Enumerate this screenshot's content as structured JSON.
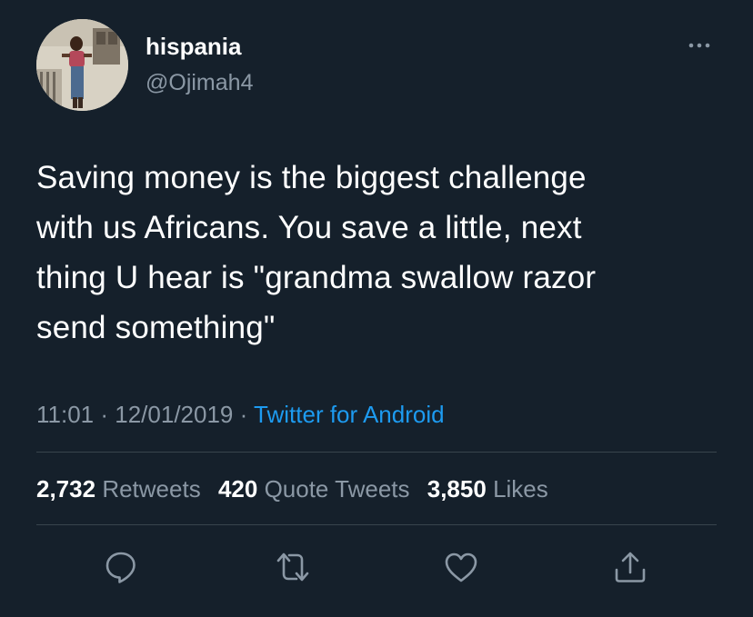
{
  "user": {
    "display_name": "hispania",
    "handle": "@Ojimah4"
  },
  "tweet": {
    "text": "Saving money is the biggest challenge\nwith us Africans. You save a little, next\nthing U hear is \"grandma swallow razor\nsend something\"",
    "time": "11:01",
    "date": "12/01/2019",
    "separator": " · ",
    "source": "Twitter for Android"
  },
  "stats": {
    "retweets_count": "2,732",
    "retweets_label": "Retweets",
    "quotes_count": "420",
    "quotes_label": "Quote Tweets",
    "likes_count": "3,850",
    "likes_label": "Likes"
  },
  "icons": {
    "more": "more-horizontal-icon",
    "reply": "reply-icon",
    "retweet": "retweet-icon",
    "like": "heart-icon",
    "share": "share-icon"
  },
  "colors": {
    "background": "#15202b",
    "text": "#ffffff",
    "secondary_text": "#8b98a5",
    "link": "#1d9bf0",
    "divider": "#38444d"
  }
}
